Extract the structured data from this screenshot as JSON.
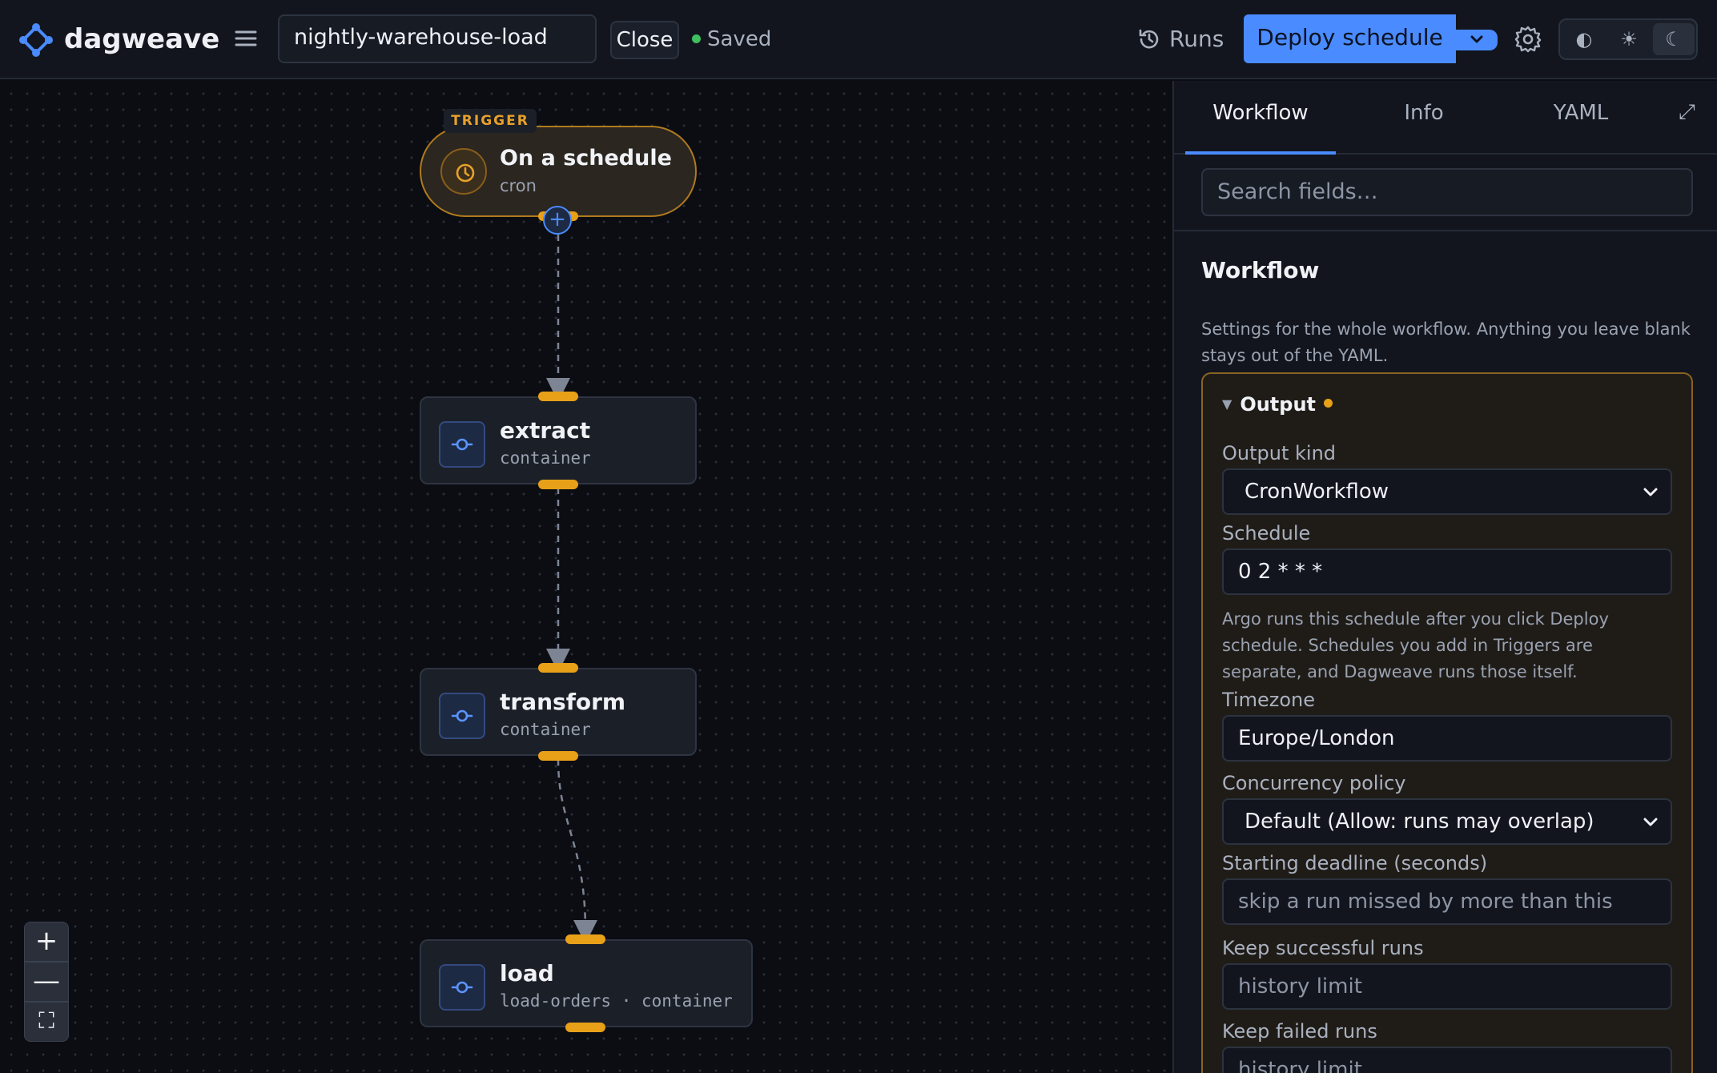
{
  "app": {
    "name": "dagweave"
  },
  "header": {
    "workflow_name": "nightly-warehouse-load",
    "close_label": "Close",
    "status_label": "Saved",
    "runs_label": "Runs",
    "deploy_label": "Deploy schedule"
  },
  "theme": {
    "options": [
      "◐",
      "☀",
      "☾"
    ],
    "active": "dark"
  },
  "canvas": {
    "trigger": {
      "tag": "TRIGGER",
      "title": "On a schedule",
      "subtitle": "cron"
    },
    "nodes": [
      {
        "title": "extract",
        "subtitle": "container"
      },
      {
        "title": "transform",
        "subtitle": "container"
      },
      {
        "title": "load",
        "subtitle": "load-orders · container"
      }
    ],
    "zoom_controls": {
      "zoom_in": "+",
      "zoom_out": "—",
      "fit": "⛶"
    }
  },
  "panel": {
    "tabs": [
      "Workflow",
      "Info",
      "YAML"
    ],
    "active_tab": "Workflow",
    "search_placeholder": "Search fields…",
    "section_title": "Workflow",
    "section_description": "Settings for the whole workflow. Anything you leave blank stays out of the YAML.",
    "output": {
      "title": "Output",
      "output_kind": {
        "label": "Output kind",
        "value": "CronWorkflow"
      },
      "schedule": {
        "label": "Schedule",
        "value": "0 2 * * *"
      },
      "schedule_help": "Argo runs this schedule after you click Deploy schedule. Schedules you add in Triggers are separate, and Dagweave runs those itself.",
      "timezone": {
        "label": "Timezone",
        "value": "Europe/London"
      },
      "concurrency": {
        "label": "Concurrency policy",
        "value": "Default (Allow: runs may overlap)"
      },
      "starting_deadline": {
        "label": "Starting deadline (seconds)",
        "placeholder": "skip a run missed by more than this"
      },
      "keep_successful": {
        "label": "Keep successful runs",
        "placeholder": "history limit"
      },
      "keep_failed": {
        "label": "Keep failed runs",
        "placeholder": "history limit"
      }
    }
  },
  "colors": {
    "accent": "#4a8bff",
    "port": "#e8a019",
    "trigger_border": "#b07a1e",
    "saved_dot": "#3fbf5f"
  }
}
